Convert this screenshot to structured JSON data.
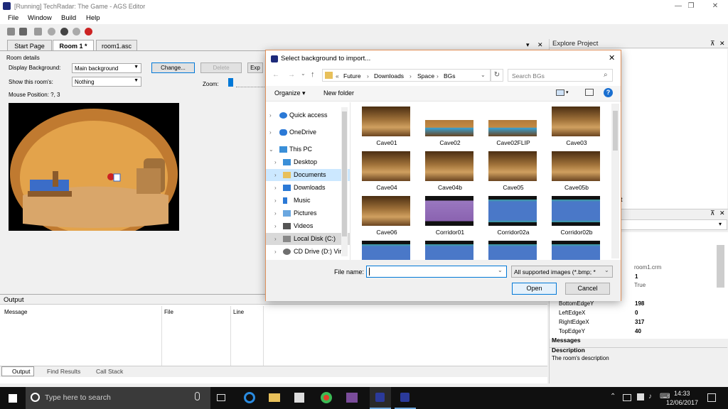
{
  "window": {
    "title": "[Running] TechRadar: The Game - AGS Editor",
    "min": "—",
    "max": "❐",
    "close": "✕"
  },
  "menu": [
    "File",
    "Window",
    "Build",
    "Help"
  ],
  "tabs": [
    {
      "label": "Start Page"
    },
    {
      "label": "Room 1 *"
    },
    {
      "label": "room1.asc"
    }
  ],
  "tab_bar": {
    "dropdown": "▾",
    "close": "✕"
  },
  "room": {
    "section_title": "Room details",
    "display_bg_label": "Display Background:",
    "display_bg_value": "Main background",
    "show_label": "Show this room's:",
    "show_value": "Nothing",
    "change_btn": "Change...",
    "delete_btn": "Delete",
    "export_btn": "Exp",
    "zoom_label": "Zoom:",
    "mouse_pos": "Mouse Position: ?, 3"
  },
  "explore": {
    "title": "Explore Project",
    "pin": "⊼",
    "close": "✕",
    "fragment": "t"
  },
  "props": {
    "pin": "⊼",
    "close": "✕",
    "dropdown": "▾",
    "values_top": [
      "room1.crm",
      "1",
      "True"
    ],
    "rows": [
      {
        "name": "BottomEdgeY",
        "value": "198"
      },
      {
        "name": "LeftEdgeX",
        "value": "0"
      },
      {
        "name": "RightEdgeX",
        "value": "317"
      },
      {
        "name": "TopEdgeY",
        "value": "40"
      }
    ],
    "section": "Messages",
    "desc_title": "Description",
    "desc_text": "The room's description"
  },
  "output": {
    "title": "Output",
    "columns": [
      "Message",
      "File",
      "Line"
    ],
    "tabs": [
      "Output",
      "Find Results",
      "Call Stack"
    ]
  },
  "dialog": {
    "title": "Select background to import...",
    "close": "✕",
    "breadcrumb": [
      "«",
      "Future",
      "›",
      "Downloads",
      "›",
      "Space",
      "›",
      "BGs"
    ],
    "search_placeholder": "Search BGs",
    "organize": "Organize ▾",
    "new_folder": "New folder",
    "nav": [
      "Quick access",
      "OneDrive",
      "This PC",
      "Desktop",
      "Documents",
      "Downloads",
      "Music",
      "Pictures",
      "Videos",
      "Local Disk (C:)",
      "CD Drive (D:) Vir"
    ],
    "files": [
      "Cave01",
      "Cave02",
      "Cave02FLIP",
      "Cave03",
      "Cave04",
      "Cave04b",
      "Cave05",
      "Cave05b",
      "Cave06",
      "Corridor01",
      "Corridor02a",
      "Corridor02b"
    ],
    "filename_label": "File name:",
    "filename_value": "",
    "filter": "All supported images (*.bmp; *",
    "open_btn": "Open",
    "cancel_btn": "Cancel"
  },
  "taskbar": {
    "search_placeholder": "Type here to search",
    "time": "14:33",
    "date": "12/06/2017"
  },
  "colors": {
    "accent": "#0078d7",
    "dialog_border": "#e0905a",
    "taskbar": "#101010"
  }
}
